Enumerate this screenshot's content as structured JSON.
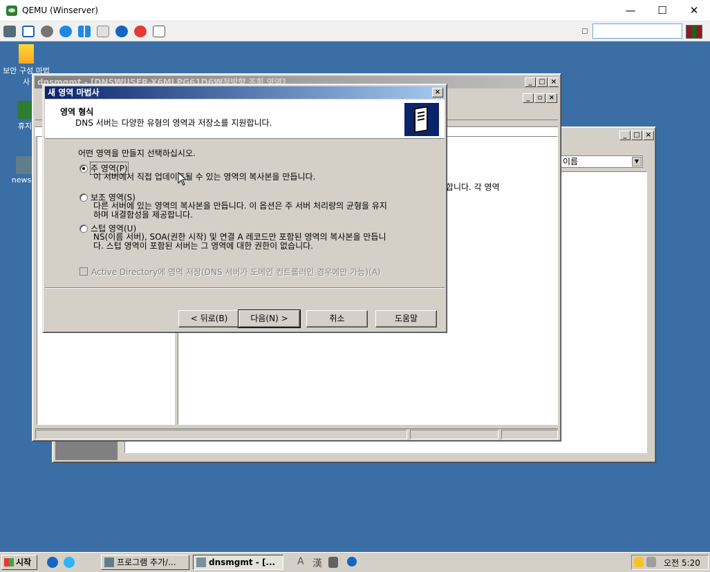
{
  "host": {
    "title": "QEMU (Winserver)",
    "controls": {
      "minimize": "—",
      "maximize": "☐",
      "close": "✕"
    }
  },
  "desktop_icons": [
    {
      "label": "보안 구성 마법사",
      "icon": "security-wizard-icon"
    },
    {
      "label": "휴지",
      "icon": "recycle-bin-icon"
    },
    {
      "label": "newsid",
      "icon": "newsid-icon"
    }
  ],
  "dnsmgmt": {
    "title": "dnsmgmt - [DNS₩USER-X6MLPG61D6₩정방향 조회 영역]",
    "fragment_text": "록 허용합니다. 각 영역",
    "dropdown_value": "이름"
  },
  "wizard": {
    "title": "새 영역 마법사",
    "header_title": "영역 형식",
    "header_subtitle": "DNS 서버는 다양한 유형의 영역과 저장소를 지원합니다.",
    "prompt": "어떤 영역을 만들지 선택하십시오.",
    "options": [
      {
        "label": "주 영역(P)",
        "selected": true,
        "desc": [
          "이 서버에서 직접 업데이트될 수 있는 영역의 복사본을 만듭니다."
        ]
      },
      {
        "label": "보조 영역(S)",
        "selected": false,
        "desc": [
          "다른 서버에 있는 영역의 복사본을 만듭니다. 이 옵션은 주 서버 처리량의 균형을 유지",
          "하며 내결함성을 제공합니다."
        ]
      },
      {
        "label": "스텁 영역(U)",
        "selected": false,
        "desc": [
          "NS(이름 서버), SOA(권한 시작) 및 연결 A 레코드만 포함된 영역의 복사본을 만듭니",
          "다. 스텁 영역이 포함된 서버는 그 영역에 대한 권한이 없습니다."
        ]
      }
    ],
    "ad_checkbox": {
      "label": "Active Directory에 영역 저장(DNS 서버가 도메인 컨트롤러인 경우에만 가능)(A)",
      "checked": false,
      "enabled": false
    },
    "buttons": {
      "back": "< 뒤로(B)",
      "next": "다음(N) >",
      "cancel": "취소",
      "help": "도움말"
    }
  },
  "taskbar": {
    "start": "시작",
    "tasks": [
      {
        "label": "프로그램 추가/...",
        "active": false
      },
      {
        "label": "dnsmgmt - [...",
        "active": true
      }
    ],
    "ime": {
      "a": "A",
      "hanja": "漢"
    },
    "clock": "오전 5:20"
  },
  "colors": {
    "desktop": "#3a6ea5",
    "active_caption": "#0a246a",
    "dialog_face": "#d4d0c8"
  }
}
